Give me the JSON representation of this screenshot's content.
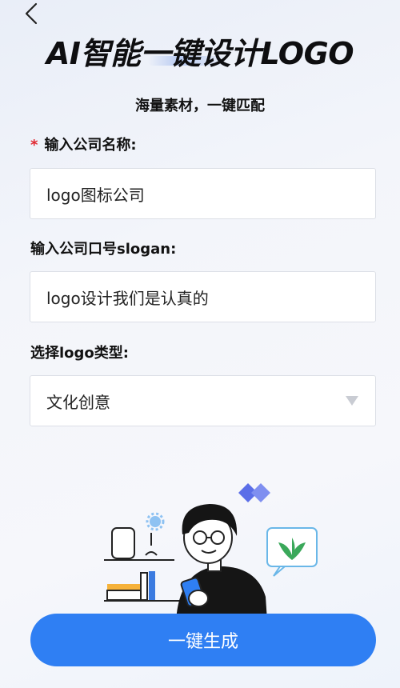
{
  "header": {
    "title": "AI智能一键设计LOGO",
    "subtitle": "海量素材，一键匹配"
  },
  "form": {
    "company_name": {
      "required_mark": "*",
      "label": "输入公司名称:",
      "value": "logo图标公司"
    },
    "slogan": {
      "label": "输入公司口号slogan:",
      "value": "logo设计我们是认真的"
    },
    "logo_type": {
      "label": "选择logo类型:",
      "selected": "文化创意"
    }
  },
  "actions": {
    "generate_label": "一键生成"
  },
  "colors": {
    "accent": "#2f7ff3",
    "required": "#e0262f",
    "background": "#f3f5fa"
  },
  "icons": {
    "back": "chevron-left-icon",
    "dropdown": "triangle-down-icon"
  }
}
